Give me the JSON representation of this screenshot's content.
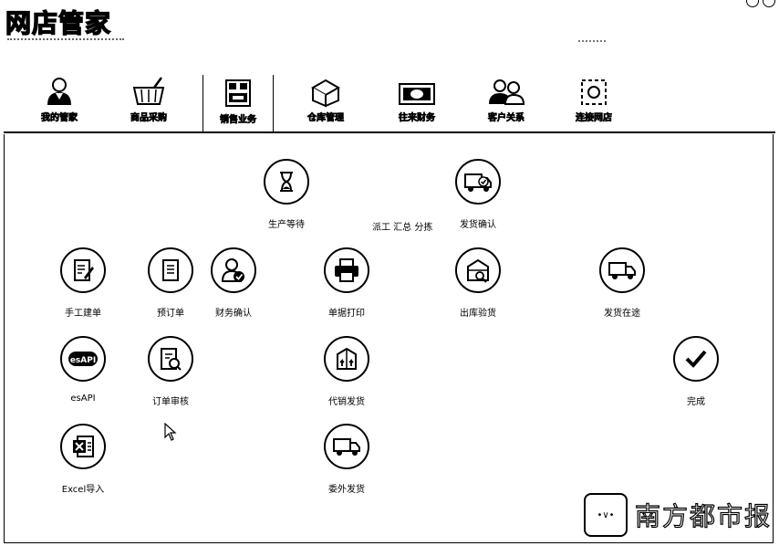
{
  "app": {
    "title": "网店管家"
  },
  "toolbar": {
    "tabs": [
      {
        "label": "我的管家",
        "icon": "butler-icon"
      },
      {
        "label": "商品采购",
        "icon": "basket-icon"
      },
      {
        "label": "销售业务",
        "icon": "cash-register-icon"
      },
      {
        "label": "仓库管理",
        "icon": "warehouse-icon"
      },
      {
        "label": "往来财务",
        "icon": "money-icon"
      },
      {
        "label": "客户关系",
        "icon": "customers-icon"
      },
      {
        "label": "连接网店",
        "icon": "shop-connect-icon"
      }
    ],
    "active_index": 2
  },
  "flow": {
    "middle_text": "派工 汇总 分拣",
    "nodes": [
      {
        "label": "生产等待",
        "icon": "hourglass-icon"
      },
      {
        "label": "发货确认",
        "icon": "truck-check-icon"
      },
      {
        "label": "手工建单",
        "icon": "manual-order-icon"
      },
      {
        "label": "预订单",
        "icon": "preorder-icon"
      },
      {
        "label": "财务确认",
        "icon": "finance-confirm-icon"
      },
      {
        "label": "单据打印",
        "icon": "printer-icon"
      },
      {
        "label": "出库验货",
        "icon": "outbound-inspect-icon"
      },
      {
        "label": "发货在途",
        "icon": "truck-transit-icon"
      },
      {
        "label": "esAPI",
        "icon": "esapi-icon"
      },
      {
        "label": "订单审核",
        "icon": "order-review-icon"
      },
      {
        "label": "代销发货",
        "icon": "consign-ship-icon"
      },
      {
        "label": "完成",
        "icon": "done-check-icon"
      },
      {
        "label": "Excel导入",
        "icon": "excel-import-icon"
      },
      {
        "label": "委外发货",
        "icon": "outsource-ship-icon"
      }
    ]
  },
  "watermark": {
    "text": "南方都市报",
    "logo_text": "•∨•"
  }
}
